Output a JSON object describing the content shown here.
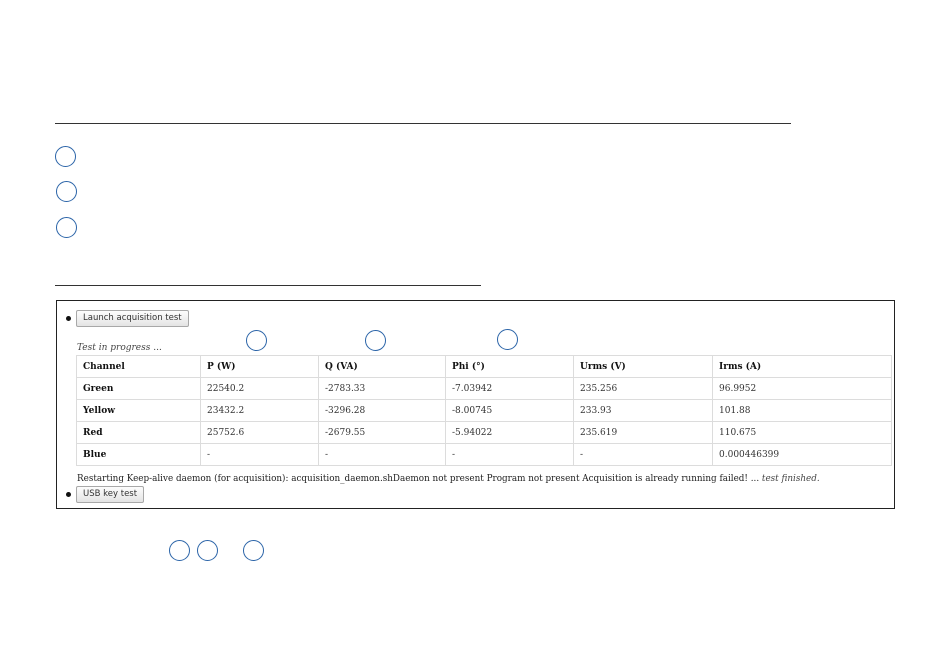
{
  "acquisition": {
    "launch_button": "Launch acquisition test",
    "status": "Test in progress ...",
    "log_message": "Restarting Keep-alive daemon (for acquisition): acquisition_daemon.shDaemon not present Program not present Acquisition is already running failed! ...",
    "log_finished": "test finished."
  },
  "table": {
    "headers": [
      "Channel",
      "P (W)",
      "Q (VA)",
      "Phi (°)",
      "Urms (V)",
      "Irms (A)"
    ],
    "rows": [
      [
        "Green",
        "22540.2",
        "-2783.33",
        "-7.03942",
        "235.256",
        "96.9952"
      ],
      [
        "Yellow",
        "23432.2",
        "-3296.28",
        "-8.00745",
        "233.93",
        "101.88"
      ],
      [
        "Red",
        "25752.6",
        "-2679.55",
        "-5.94022",
        "235.619",
        "110.675"
      ],
      [
        "Blue",
        "-",
        "-",
        "-",
        "-",
        "0.000446399"
      ]
    ]
  },
  "usb": {
    "button": "USB key test"
  },
  "colors": {
    "callout": "#2b64a8",
    "rule": "#333333"
  }
}
